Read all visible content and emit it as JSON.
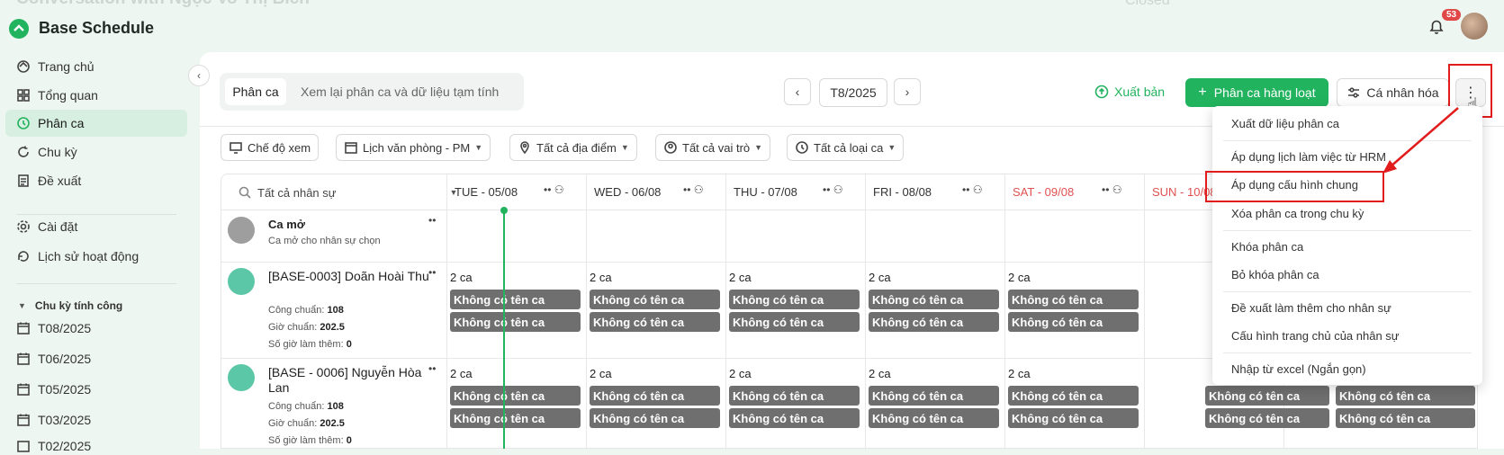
{
  "app": {
    "title": "Base Schedule",
    "ghost_title": "Conversation with Ngọc Vo Thị Bích",
    "ghost_closed": "Closed",
    "notifications": "53"
  },
  "sidebar": {
    "items": [
      {
        "label": "Trang chủ",
        "icon": "home-icon"
      },
      {
        "label": "Tổng quan",
        "icon": "grid-icon"
      },
      {
        "label": "Phân ca",
        "icon": "clock-icon",
        "active": true
      },
      {
        "label": "Chu kỳ",
        "icon": "cycle-icon"
      },
      {
        "label": "Đề xuất",
        "icon": "document-icon"
      },
      {
        "label": "Cài đặt",
        "icon": "gear-icon"
      },
      {
        "label": "Lịch sử hoạt động",
        "icon": "history-icon"
      }
    ],
    "period_header": "Chu kỳ tính công",
    "periods": [
      "T08/2025",
      "T06/2025",
      "T05/2025",
      "T03/2025",
      "T02/2025"
    ]
  },
  "toolbar": {
    "tab_active": "Phân ca",
    "tab_other": "Xem lại phân ca và dữ liệu tạm tính",
    "month": "T8/2025",
    "publish": "Xuất bản",
    "bulk": "Phân ca hàng loạt",
    "personal": "Cá nhân hóa",
    "more": "⋮"
  },
  "filters": [
    "Chế độ xem",
    "Lịch văn phòng - PM",
    "Tất cả địa điểm",
    "Tất cả vai trò",
    "Tất cả loại ca"
  ],
  "grid": {
    "staff_filter": "Tất cả nhân sự",
    "days": [
      {
        "label": "TUE - 05/08",
        "weekend": false
      },
      {
        "label": "WED - 06/08",
        "weekend": false
      },
      {
        "label": "THU - 07/08",
        "weekend": false
      },
      {
        "label": "FRI - 08/08",
        "weekend": false
      },
      {
        "label": "SAT - 09/08",
        "weekend": true
      },
      {
        "label": "SUN - 10/08",
        "weekend": true
      }
    ],
    "open_shift": {
      "title": "Ca mở",
      "subtitle": "Ca mở cho nhân sự chọn"
    },
    "employees": [
      {
        "name": "[BASE-0003] Doãn Hoài Thu",
        "std_label": "Công chuẩn:",
        "std": "108",
        "hours_label": "Giờ chuẩn:",
        "hours": "202.5",
        "ot_label": "Số giờ làm thêm:",
        "ot": "0"
      },
      {
        "name": "[BASE - 0006] Nguyễn Hòa Lan",
        "std_label": "Công chuẩn:",
        "std": "108",
        "hours_label": "Giờ chuẩn:",
        "hours": "202.5",
        "ot_label": "Số giờ làm thêm:",
        "ot": "0"
      }
    ],
    "shift_count": "2 ca",
    "shift_name": "Không có tên ca"
  },
  "menu": {
    "items": [
      "Xuất dữ liệu phân ca",
      "Áp dụng lịch làm việc từ HRM",
      "Áp dụng cấu hình chung",
      "Xóa phân ca trong chu kỳ",
      "Khóa phân ca",
      "Bỏ khóa phân ca",
      "Đề xuất làm thêm cho nhân sự",
      "Cấu hình trang chủ của nhân sự",
      "Nhập từ excel (Ngắn gọn)"
    ]
  },
  "colors": {
    "accent": "#22b35e",
    "highlight": "#e21c1c",
    "shift": "#6f6f6f",
    "weekend": "#e05050"
  }
}
